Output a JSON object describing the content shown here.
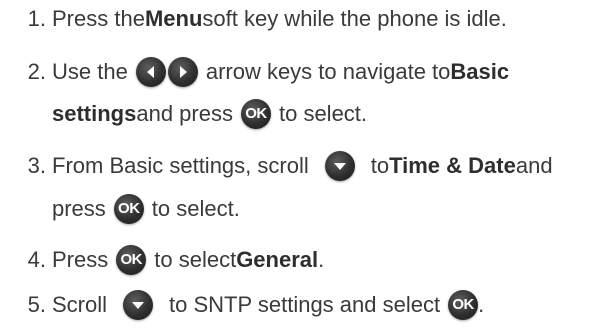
{
  "steps": [
    {
      "number": "1.",
      "parts": {
        "a": "Press the ",
        "b": "Menu",
        "c": " soft key while the phone is idle."
      }
    },
    {
      "number": "2.",
      "parts": {
        "a": "Use the",
        "b": "arrow keys to navigate to ",
        "c": "Basic"
      },
      "cont": {
        "a": "settings",
        "b": " and press",
        "c": "to select."
      }
    },
    {
      "number": "3.",
      "parts": {
        "a": "From Basic settings, scroll",
        "b": "to ",
        "c": "Time & Date",
        "d": " and"
      },
      "cont": {
        "a": "press",
        "b": "to select."
      }
    },
    {
      "number": "4.",
      "parts": {
        "a": "Press",
        "b": "to select ",
        "c": "General",
        "d": "."
      }
    },
    {
      "number": "5.",
      "parts": {
        "a": "Scroll",
        "b": "to SNTP settings and select",
        "c": "."
      }
    }
  ],
  "icons": {
    "ok_label": "OK",
    "left": "left-arrow-icon",
    "right": "right-arrow-icon",
    "down": "down-arrow-icon",
    "ok": "ok-key-icon"
  }
}
